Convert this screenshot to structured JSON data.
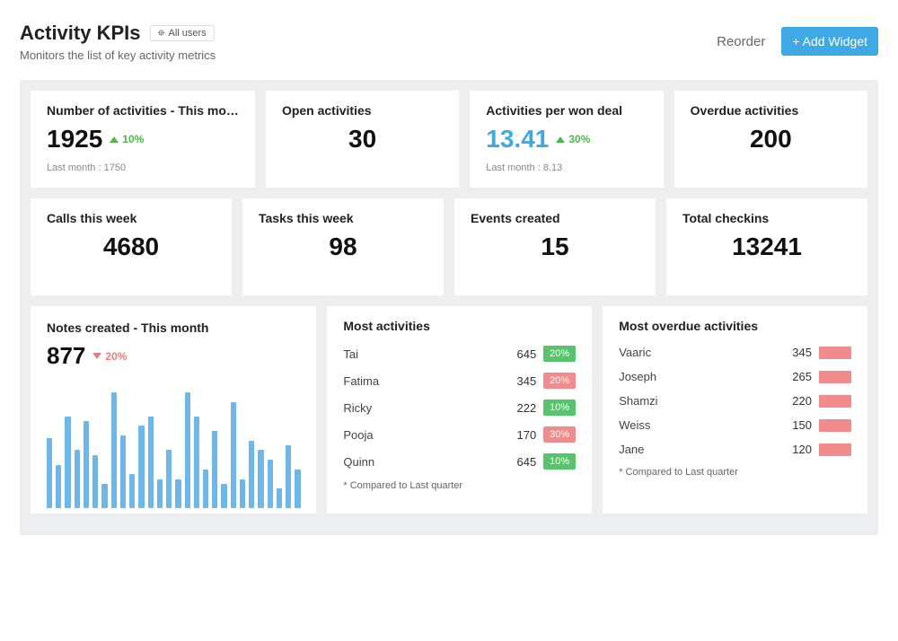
{
  "header": {
    "title": "Activity KPIs",
    "filter_label": "All users",
    "subtitle": "Monitors the list of key activity metrics",
    "reorder_label": "Reorder",
    "add_widget_label": "+ Add Widget"
  },
  "cards": {
    "num_activities": {
      "title": "Number of activities - This mo…",
      "value": "1925",
      "delta": "10%",
      "direction": "up",
      "prev": "Last month : 1750"
    },
    "open_activities": {
      "title": "Open activities",
      "value": "30"
    },
    "per_won_deal": {
      "title": "Activities per won deal",
      "value": "13.41",
      "delta": "30%",
      "direction": "up",
      "prev": "Last month : 8.13"
    },
    "overdue": {
      "title": "Overdue activities",
      "value": "200"
    },
    "calls_week": {
      "title": "Calls this week",
      "value": "4680"
    },
    "tasks_week": {
      "title": "Tasks this week",
      "value": "98"
    },
    "events_created": {
      "title": "Events created",
      "value": "15"
    },
    "total_checkins": {
      "title": "Total checkins",
      "value": "13241"
    },
    "notes_created": {
      "title": "Notes created - This month",
      "value": "877",
      "delta": "20%",
      "direction": "down"
    }
  },
  "chart_data": {
    "type": "bar",
    "title": "Notes created - This month",
    "values": [
      72,
      45,
      95,
      60,
      90,
      55,
      25,
      120,
      75,
      35,
      85,
      95,
      30,
      60,
      30,
      120,
      95,
      40,
      80,
      25,
      110,
      30,
      70,
      60,
      50,
      20,
      65,
      40
    ],
    "xlabel": "",
    "ylabel": "",
    "ylim": [
      0,
      130
    ]
  },
  "most_activities": {
    "title": "Most activities",
    "rows": [
      {
        "name": "Tai",
        "value": "645",
        "pct": "20%",
        "tone": "green"
      },
      {
        "name": "Fatima",
        "value": "345",
        "pct": "20%",
        "tone": "red"
      },
      {
        "name": "Ricky",
        "value": "222",
        "pct": "10%",
        "tone": "green"
      },
      {
        "name": "Pooja",
        "value": "170",
        "pct": "30%",
        "tone": "red"
      },
      {
        "name": "Quinn",
        "value": "645",
        "pct": "10%",
        "tone": "green"
      }
    ],
    "footnote": "Compared to Last quarter"
  },
  "most_overdue": {
    "title": "Most overdue activities",
    "rows": [
      {
        "name": "Vaaric",
        "value": "345"
      },
      {
        "name": "Joseph",
        "value": "265"
      },
      {
        "name": "Shamzi",
        "value": "220"
      },
      {
        "name": "Weiss",
        "value": "150"
      },
      {
        "name": "Jane",
        "value": "120"
      }
    ],
    "footnote": "Compared to Last quarter"
  }
}
